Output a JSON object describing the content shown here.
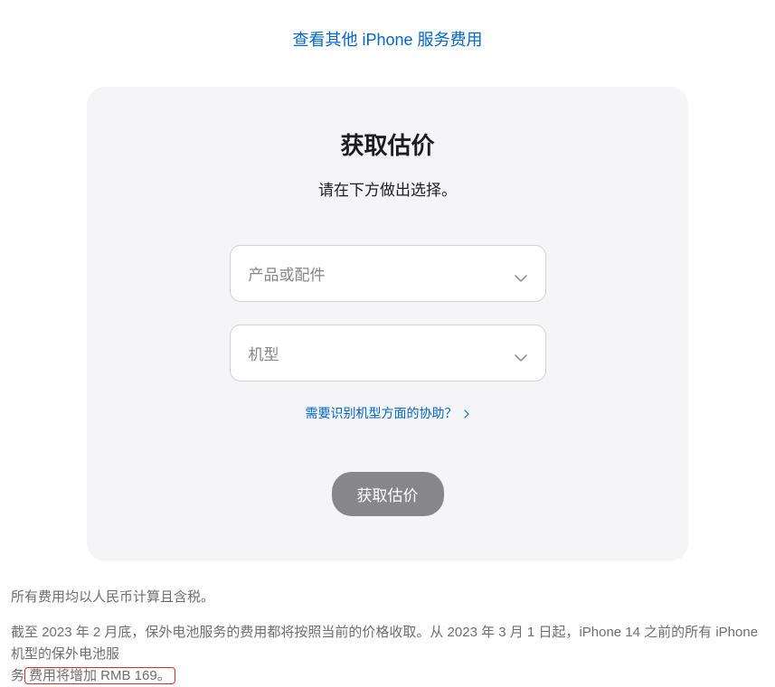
{
  "topLink": "查看其他 iPhone 服务费用",
  "card": {
    "title": "获取估价",
    "subtitle": "请在下方做出选择。",
    "dropdown1": "产品或配件",
    "dropdown2": "机型",
    "helpLink": "需要识别机型方面的协助？",
    "button": "获取估价"
  },
  "footer": {
    "line1": "所有费用均以人民币计算且含税。",
    "line2_part1": "截至 2023 年 2 月底，保外电池服务的费用都将按照当前的价格收取。从 2023 年 3 月 1 日起，iPhone 14 之前的所有 iPhone 机型的保外电池服",
    "line2_part2_seg1": "务",
    "line2_part2_highlight": "费用将增加 RMB 169。"
  }
}
